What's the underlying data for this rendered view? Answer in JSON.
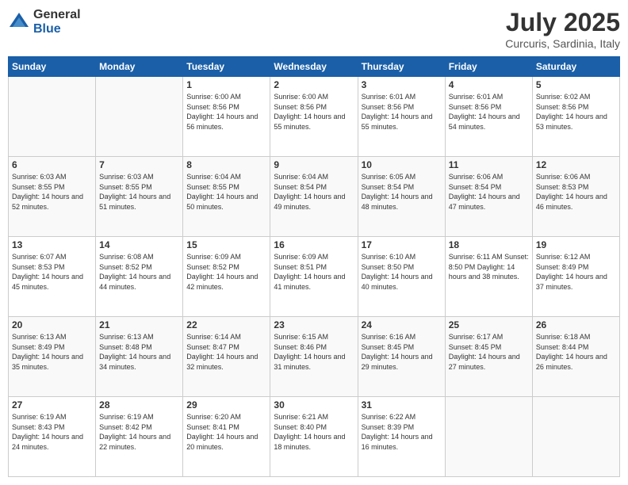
{
  "logo": {
    "general": "General",
    "blue": "Blue"
  },
  "title": "July 2025",
  "subtitle": "Curcuris, Sardinia, Italy",
  "days_of_week": [
    "Sunday",
    "Monday",
    "Tuesday",
    "Wednesday",
    "Thursday",
    "Friday",
    "Saturday"
  ],
  "weeks": [
    [
      {
        "day": "",
        "info": ""
      },
      {
        "day": "",
        "info": ""
      },
      {
        "day": "1",
        "info": "Sunrise: 6:00 AM\nSunset: 8:56 PM\nDaylight: 14 hours and 56 minutes."
      },
      {
        "day": "2",
        "info": "Sunrise: 6:00 AM\nSunset: 8:56 PM\nDaylight: 14 hours and 55 minutes."
      },
      {
        "day": "3",
        "info": "Sunrise: 6:01 AM\nSunset: 8:56 PM\nDaylight: 14 hours and 55 minutes."
      },
      {
        "day": "4",
        "info": "Sunrise: 6:01 AM\nSunset: 8:56 PM\nDaylight: 14 hours and 54 minutes."
      },
      {
        "day": "5",
        "info": "Sunrise: 6:02 AM\nSunset: 8:56 PM\nDaylight: 14 hours and 53 minutes."
      }
    ],
    [
      {
        "day": "6",
        "info": "Sunrise: 6:03 AM\nSunset: 8:55 PM\nDaylight: 14 hours and 52 minutes."
      },
      {
        "day": "7",
        "info": "Sunrise: 6:03 AM\nSunset: 8:55 PM\nDaylight: 14 hours and 51 minutes."
      },
      {
        "day": "8",
        "info": "Sunrise: 6:04 AM\nSunset: 8:55 PM\nDaylight: 14 hours and 50 minutes."
      },
      {
        "day": "9",
        "info": "Sunrise: 6:04 AM\nSunset: 8:54 PM\nDaylight: 14 hours and 49 minutes."
      },
      {
        "day": "10",
        "info": "Sunrise: 6:05 AM\nSunset: 8:54 PM\nDaylight: 14 hours and 48 minutes."
      },
      {
        "day": "11",
        "info": "Sunrise: 6:06 AM\nSunset: 8:54 PM\nDaylight: 14 hours and 47 minutes."
      },
      {
        "day": "12",
        "info": "Sunrise: 6:06 AM\nSunset: 8:53 PM\nDaylight: 14 hours and 46 minutes."
      }
    ],
    [
      {
        "day": "13",
        "info": "Sunrise: 6:07 AM\nSunset: 8:53 PM\nDaylight: 14 hours and 45 minutes."
      },
      {
        "day": "14",
        "info": "Sunrise: 6:08 AM\nSunset: 8:52 PM\nDaylight: 14 hours and 44 minutes."
      },
      {
        "day": "15",
        "info": "Sunrise: 6:09 AM\nSunset: 8:52 PM\nDaylight: 14 hours and 42 minutes."
      },
      {
        "day": "16",
        "info": "Sunrise: 6:09 AM\nSunset: 8:51 PM\nDaylight: 14 hours and 41 minutes."
      },
      {
        "day": "17",
        "info": "Sunrise: 6:10 AM\nSunset: 8:50 PM\nDaylight: 14 hours and 40 minutes."
      },
      {
        "day": "18",
        "info": "Sunrise: 6:11 AM\nSunset: 8:50 PM\nDaylight: 14 hours and 38 minutes."
      },
      {
        "day": "19",
        "info": "Sunrise: 6:12 AM\nSunset: 8:49 PM\nDaylight: 14 hours and 37 minutes."
      }
    ],
    [
      {
        "day": "20",
        "info": "Sunrise: 6:13 AM\nSunset: 8:49 PM\nDaylight: 14 hours and 35 minutes."
      },
      {
        "day": "21",
        "info": "Sunrise: 6:13 AM\nSunset: 8:48 PM\nDaylight: 14 hours and 34 minutes."
      },
      {
        "day": "22",
        "info": "Sunrise: 6:14 AM\nSunset: 8:47 PM\nDaylight: 14 hours and 32 minutes."
      },
      {
        "day": "23",
        "info": "Sunrise: 6:15 AM\nSunset: 8:46 PM\nDaylight: 14 hours and 31 minutes."
      },
      {
        "day": "24",
        "info": "Sunrise: 6:16 AM\nSunset: 8:45 PM\nDaylight: 14 hours and 29 minutes."
      },
      {
        "day": "25",
        "info": "Sunrise: 6:17 AM\nSunset: 8:45 PM\nDaylight: 14 hours and 27 minutes."
      },
      {
        "day": "26",
        "info": "Sunrise: 6:18 AM\nSunset: 8:44 PM\nDaylight: 14 hours and 26 minutes."
      }
    ],
    [
      {
        "day": "27",
        "info": "Sunrise: 6:19 AM\nSunset: 8:43 PM\nDaylight: 14 hours and 24 minutes."
      },
      {
        "day": "28",
        "info": "Sunrise: 6:19 AM\nSunset: 8:42 PM\nDaylight: 14 hours and 22 minutes."
      },
      {
        "day": "29",
        "info": "Sunrise: 6:20 AM\nSunset: 8:41 PM\nDaylight: 14 hours and 20 minutes."
      },
      {
        "day": "30",
        "info": "Sunrise: 6:21 AM\nSunset: 8:40 PM\nDaylight: 14 hours and 18 minutes."
      },
      {
        "day": "31",
        "info": "Sunrise: 6:22 AM\nSunset: 8:39 PM\nDaylight: 14 hours and 16 minutes."
      },
      {
        "day": "",
        "info": ""
      },
      {
        "day": "",
        "info": ""
      }
    ]
  ]
}
